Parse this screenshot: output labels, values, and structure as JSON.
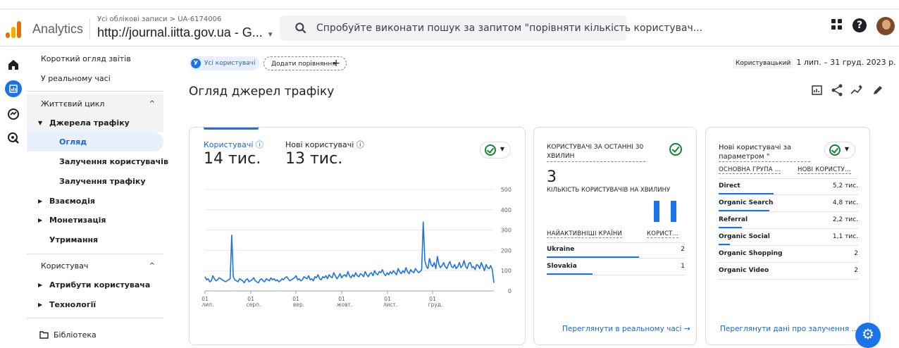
{
  "header": {
    "app_name": "Analytics",
    "account_crumb": "Усі облікові записи > UA-6174006",
    "property": "http://journal.iitta.gov.ua - G...",
    "search_placeholder": "Спробуйте виконати пошук за запитом \"порівняти кількість користувач..."
  },
  "nav": {
    "items": [
      {
        "label": "Короткий огляд звітів"
      },
      {
        "label": "У реальному часі"
      },
      {
        "label": "Життєвий цикл"
      },
      {
        "label": "Джерела трафіку"
      },
      {
        "label": "Огляд"
      },
      {
        "label": "Залучення користувачів"
      },
      {
        "label": "Залучення трафіку"
      },
      {
        "label": "Взаємодія"
      },
      {
        "label": "Монетизація"
      },
      {
        "label": "Утримання"
      },
      {
        "label": "Користувач"
      },
      {
        "label": "Атрибути користувача"
      },
      {
        "label": "Технології"
      },
      {
        "label": "Бібліотека"
      }
    ]
  },
  "toolbar": {
    "segment_chip": "Усі користувачі",
    "segment_chip_letter": "У",
    "add_comparison": "Додати порівняння",
    "date_label": "Користувацький",
    "date_range": "1 лип. – 31 груд. 2023 р."
  },
  "page_title": "Огляд джерел трафіку",
  "card_overview": {
    "metric1_label": "Користувачі",
    "metric1_value": "14 тис.",
    "metric2_label": "Нові користувачі",
    "metric2_value": "13 тис."
  },
  "chart_data": {
    "type": "line",
    "title": "",
    "xlabel": "",
    "ylabel": "",
    "ylim": [
      0,
      500
    ],
    "yticks": [
      "500",
      "400",
      "300",
      "200",
      "100",
      "0"
    ],
    "xticks": [
      {
        "day": "01",
        "month": "лип."
      },
      {
        "day": "01",
        "month": "серп."
      },
      {
        "day": "01",
        "month": "вер."
      },
      {
        "day": "01",
        "month": "жовт."
      },
      {
        "day": "01",
        "month": "лист."
      },
      {
        "day": "01",
        "month": "груд."
      }
    ],
    "series": [
      {
        "color": "#1a73e8",
        "values": [
          70,
          55,
          60,
          45,
          50,
          75,
          60,
          50,
          55,
          65,
          60,
          55,
          50,
          45,
          50,
          55,
          60,
          275,
          70,
          55,
          50,
          45,
          60,
          55,
          50,
          40,
          55,
          60,
          45,
          50,
          55,
          65,
          50,
          45,
          40,
          55,
          60,
          50,
          45,
          60,
          55,
          50,
          65,
          55,
          60,
          50,
          55,
          45,
          50,
          60,
          55,
          65,
          70,
          60,
          50,
          55,
          60,
          65,
          75,
          55,
          60,
          50,
          55,
          70,
          65,
          60,
          75,
          55,
          60,
          50,
          70,
          65,
          80,
          60,
          55,
          70,
          65,
          75,
          60,
          80,
          70,
          65,
          90,
          75,
          60,
          70,
          85,
          65,
          75,
          80,
          70,
          95,
          75,
          65,
          80,
          70,
          90,
          75,
          70,
          85,
          80,
          70,
          95,
          80,
          70,
          85,
          90,
          75,
          100,
          85,
          80,
          95,
          90,
          105,
          85,
          75,
          90,
          80,
          95,
          85,
          100,
          90,
          80,
          110,
          95,
          85,
          100,
          90,
          115,
          95,
          85,
          105,
          95,
          90,
          110,
          100,
          90,
          95,
          105,
          340,
          150,
          120,
          110,
          160,
          130,
          120,
          140,
          110,
          170,
          130,
          115,
          125,
          140,
          120,
          110,
          130,
          145,
          120,
          115,
          130,
          110,
          120,
          140,
          115,
          125,
          150,
          120,
          110,
          135,
          140,
          115,
          120,
          105,
          130,
          125,
          110,
          140,
          120,
          100,
          130,
          115,
          110,
          125,
          105,
          40
        ]
      }
    ]
  },
  "card_realtime": {
    "title": "КОРИСТУВАЧІ ЗА ОСТАННІ 30 ХВИЛИН",
    "value": "3",
    "subtitle": "КІЛЬКІСТЬ КОРИСТУВАЧІВ НА ХВИЛИНУ",
    "minute_values": [
      1,
      1
    ],
    "col1": "НАЙАКТИВНІШІ КРАЇНИ",
    "col2": "КОРИСТ...",
    "rows": [
      {
        "name": "Ukraine",
        "value": "2",
        "share": 0.67
      },
      {
        "name": "Slovakia",
        "value": "1",
        "share": 0.33
      }
    ],
    "link": "Переглянути в реальному часі"
  },
  "card_new_users": {
    "title": "Нові користувачі за параметром \"",
    "col1": "ОСНОВНА ГРУПА ...",
    "col2": "НОВІ КОРИСТУ...",
    "rows": [
      {
        "name": "Direct",
        "value": "5,2 тис.",
        "share": 1.0
      },
      {
        "name": "Organic Search",
        "value": "4,8 тис.",
        "share": 0.92
      },
      {
        "name": "Referral",
        "value": "2,2 тис.",
        "share": 0.42
      },
      {
        "name": "Organic Social",
        "value": "1,1 тис.",
        "share": 0.21
      },
      {
        "name": "Organic Shopping",
        "value": "2",
        "share": 0.0
      },
      {
        "name": "Organic Video",
        "value": "2",
        "share": 0.0
      }
    ],
    "link": "Переглянути дані про залучення ..."
  },
  "colors": {
    "accent": "#1a73e8",
    "success": "#188038",
    "logo_orange": "#f9ab00",
    "logo_dark": "#e37400"
  }
}
